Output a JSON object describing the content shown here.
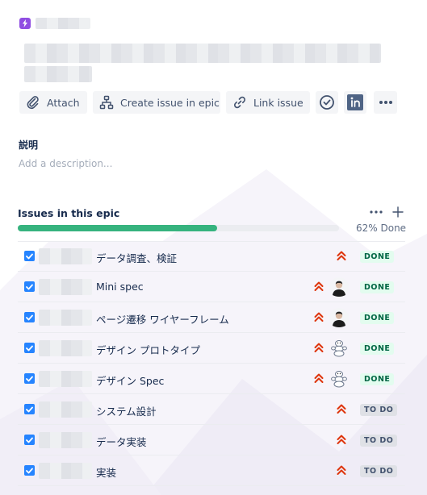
{
  "toolbar": {
    "attach_label": "Attach",
    "create_issue_label": "Create issue in epic",
    "link_issue_label": "Link issue"
  },
  "description": {
    "label": "説明",
    "placeholder": "Add a description..."
  },
  "issues": {
    "title": "Issues in this epic",
    "progress_percent": 62,
    "progress_text": "62% Done",
    "rows": [
      {
        "summary": "データ調査、検証",
        "priority": "highest",
        "assignee": "none",
        "status": "DONE"
      },
      {
        "summary": "Mini spec",
        "priority": "highest",
        "assignee": "user-photo",
        "status": "DONE"
      },
      {
        "summary": "ページ遷移 ワイヤーフレーム",
        "priority": "highest",
        "assignee": "user-photo",
        "status": "DONE"
      },
      {
        "summary": "デザイン プロトタイプ",
        "priority": "highest",
        "assignee": "mascot",
        "status": "DONE"
      },
      {
        "summary": "デザイン Spec",
        "priority": "highest",
        "assignee": "mascot",
        "status": "DONE"
      },
      {
        "summary": "システム設計",
        "priority": "highest",
        "assignee": "none",
        "status": "TO DO"
      },
      {
        "summary": "データ実装",
        "priority": "highest",
        "assignee": "none",
        "status": "TO DO"
      },
      {
        "summary": "実装",
        "priority": "highest",
        "assignee": "none",
        "status": "TO DO"
      }
    ]
  },
  "colors": {
    "epic": "#904ee2",
    "progress": "#36b37e",
    "priority": "#de350b",
    "checkbox": "#2684ff"
  },
  "icons": [
    "lightning-icon",
    "paperclip-icon",
    "hierarchy-icon",
    "link-icon",
    "check-circle-icon",
    "invision-icon",
    "more-icon",
    "plus-icon",
    "priority-highest-icon",
    "checkbox-checked-icon"
  ]
}
